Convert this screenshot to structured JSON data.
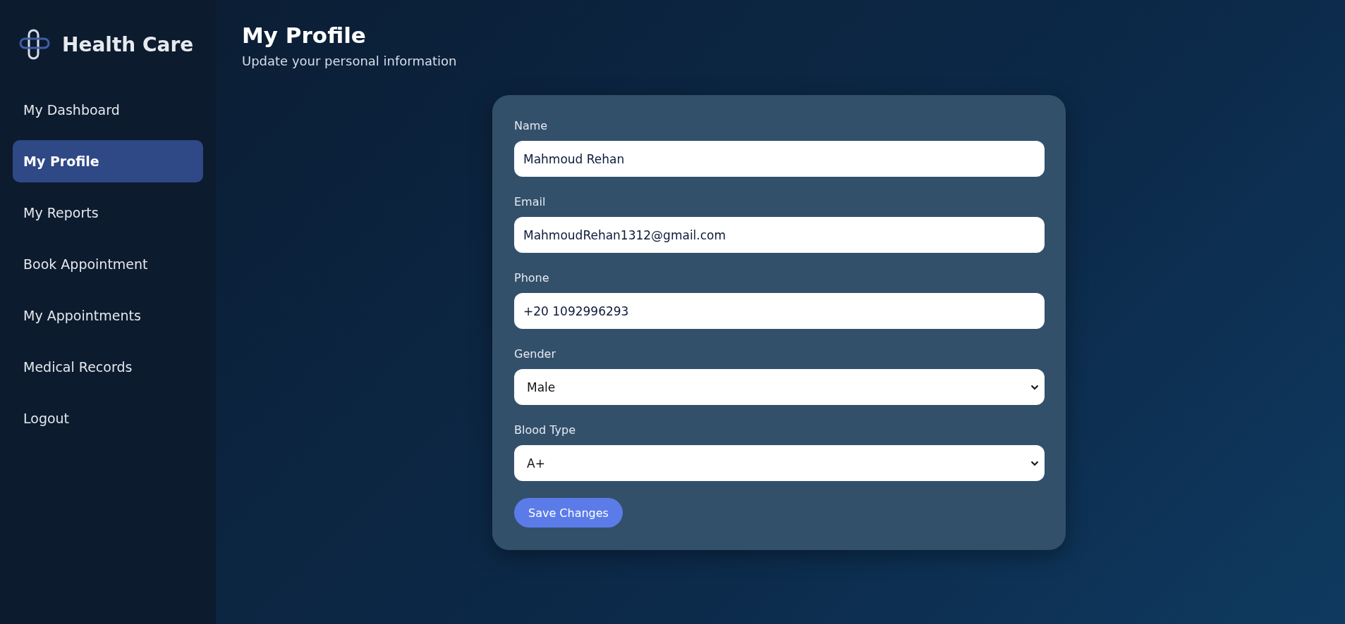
{
  "sidebar": {
    "brand": "Health Care",
    "items": [
      {
        "label": "My Dashboard",
        "selected": false
      },
      {
        "label": "My Profile",
        "selected": true
      },
      {
        "label": "My Reports",
        "selected": false
      },
      {
        "label": "Book Appointment",
        "selected": false
      },
      {
        "label": "My Appointments",
        "selected": false
      },
      {
        "label": "Medical Records",
        "selected": false
      },
      {
        "label": "Logout",
        "selected": false
      }
    ]
  },
  "header": {
    "title": "My Profile",
    "subtitle": "Update your personal information"
  },
  "form": {
    "fields": [
      {
        "label": "Name",
        "kind": "text",
        "value": "Mahmoud Rehan"
      },
      {
        "label": "Email",
        "kind": "text",
        "value": "MahmoudRehan1312@gmail.com"
      },
      {
        "label": "Phone",
        "kind": "text",
        "value": "+20 1092996293"
      },
      {
        "label": "Gender",
        "kind": "select",
        "value": "Male"
      },
      {
        "label": "Blood Type",
        "kind": "select",
        "value": "A+"
      }
    ],
    "submit": "Save Changes"
  }
}
